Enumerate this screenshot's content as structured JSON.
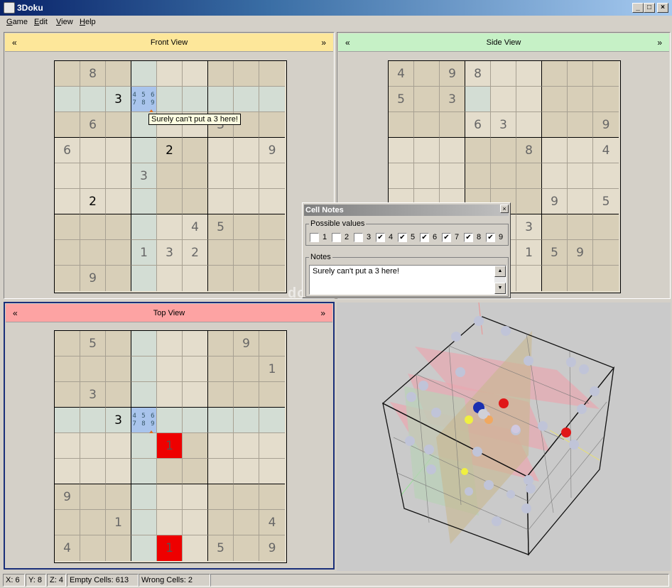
{
  "window": {
    "title": "3Doku",
    "min": "_",
    "max": "□",
    "close": "×"
  },
  "menu": [
    {
      "first": "G",
      "rest": "ame"
    },
    {
      "first": "E",
      "rest": "dit"
    },
    {
      "first": "V",
      "rest": "iew"
    },
    {
      "first": "H",
      "rest": "elp"
    }
  ],
  "nav": {
    "prev": "«",
    "next": "»"
  },
  "views": {
    "front": {
      "title": "Front View",
      "header_color": "#fde79a",
      "grid": [
        [
          "",
          "8",
          "",
          "",
          "",
          "",
          "",
          "",
          ""
        ],
        [
          "",
          "",
          "3*",
          "N",
          "",
          "",
          "",
          "",
          ""
        ],
        [
          "",
          "6",
          "",
          "",
          "",
          "",
          "3",
          "",
          ""
        ],
        [
          "6",
          "",
          "",
          "",
          "2*",
          "",
          "",
          "",
          "9"
        ],
        [
          "",
          "",
          "",
          "3",
          "",
          "",
          "",
          "",
          ""
        ],
        [
          "",
          "2*",
          "",
          "",
          "",
          "",
          "",
          "",
          ""
        ],
        [
          "",
          "",
          "",
          "",
          "",
          "4",
          "5",
          "",
          ""
        ],
        [
          "",
          "",
          "",
          "1",
          "3",
          "2",
          "",
          "",
          ""
        ],
        [
          "",
          "9",
          "",
          "",
          "",
          "",
          "",
          "",
          ""
        ]
      ],
      "highlight_row": 1,
      "highlight_col": 3,
      "selected": [
        1,
        3
      ],
      "errors": []
    },
    "side": {
      "title": "Side View",
      "header_color": "#c6f1c6",
      "grid": [
        [
          "4",
          "",
          "9",
          "8",
          "",
          "",
          "",
          "",
          ""
        ],
        [
          "5",
          "",
          "3",
          "",
          "",
          "",
          "",
          "",
          ""
        ],
        [
          "",
          "",
          "",
          "6",
          "3",
          "",
          "",
          "",
          "9"
        ],
        [
          "",
          "",
          "",
          "",
          "",
          "8",
          "",
          "",
          "4"
        ],
        [
          "",
          "",
          "",
          "",
          "",
          "",
          "",
          "",
          ""
        ],
        [
          "",
          "",
          "",
          "",
          "",
          "",
          "9",
          "",
          "5"
        ],
        [
          "",
          "",
          "",
          "",
          "",
          "3",
          "",
          "",
          ""
        ],
        [
          "",
          "",
          "",
          "",
          "",
          "1",
          "5",
          "9",
          ""
        ],
        [
          "",
          "",
          "",
          "",
          "",
          "",
          "",
          "",
          ""
        ]
      ],
      "highlight_row": -1,
      "highlight_col": -1,
      "selected": [
        1,
        3
      ],
      "errors": []
    },
    "top": {
      "title": "Top View",
      "header_color": "#fda3a3",
      "grid": [
        [
          "",
          "5",
          "",
          "",
          "",
          "",
          "",
          "9",
          ""
        ],
        [
          "",
          "",
          "",
          "",
          "",
          "",
          "",
          "",
          "1"
        ],
        [
          "",
          "3",
          "",
          "",
          "",
          "",
          "",
          "",
          ""
        ],
        [
          "",
          "",
          "3*",
          "N",
          "",
          "",
          "",
          "",
          ""
        ],
        [
          "",
          "",
          "",
          "",
          "1",
          "",
          "",
          "",
          ""
        ],
        [
          "",
          "",
          "",
          "",
          "",
          "",
          "",
          "",
          ""
        ],
        [
          "9",
          "",
          "",
          "",
          "",
          "",
          "",
          "",
          ""
        ],
        [
          "",
          "",
          "1",
          "",
          "",
          "",
          "",
          "",
          "4"
        ],
        [
          "4",
          "",
          "",
          "",
          "1",
          "",
          "5",
          "",
          "9"
        ]
      ],
      "highlight_row": 3,
      "highlight_col": 3,
      "selected": [
        3,
        3
      ],
      "errors": [
        [
          4,
          4
        ],
        [
          8,
          4
        ]
      ]
    }
  },
  "cell_notes_text": "4 5 6\n7 8 9",
  "tooltip": "Surely can't put a 3 here!",
  "dialog": {
    "title": "Cell Notes",
    "close": "×",
    "possible_label": "Possible values",
    "values": [
      {
        "label": "1",
        "checked": false
      },
      {
        "label": "2",
        "checked": false
      },
      {
        "label": "3",
        "checked": false
      },
      {
        "label": "4",
        "checked": true
      },
      {
        "label": "5",
        "checked": true
      },
      {
        "label": "6",
        "checked": true
      },
      {
        "label": "7",
        "checked": true
      },
      {
        "label": "8",
        "checked": true
      },
      {
        "label": "9",
        "checked": true
      }
    ],
    "notes_label": "Notes",
    "notes_text": "Surely can't put a 3 here!",
    "check_glyph": "✔",
    "scroll_up": "▲",
    "scroll_down": "▼"
  },
  "watermark": "download3k",
  "status": {
    "x": "X: 6",
    "y": "Y: 8",
    "z": "Z: 4",
    "empty": "Empty Cells: 613",
    "wrong": "Wrong Cells: 2"
  }
}
